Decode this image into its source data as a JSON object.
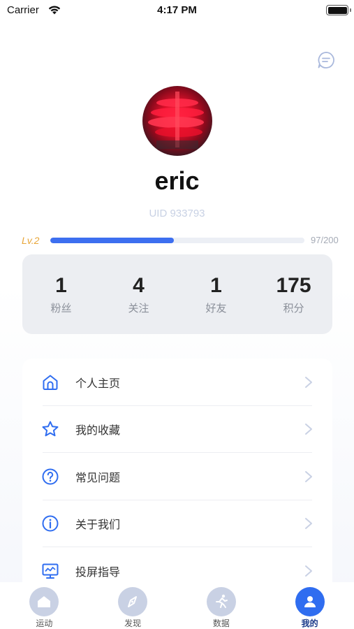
{
  "status_bar": {
    "carrier": "Carrier",
    "time": "4:17 PM"
  },
  "icons": {
    "message": "message-circle-icon",
    "tabs": [
      "home-icon",
      "compass-icon",
      "running-icon",
      "user-icon"
    ]
  },
  "profile": {
    "username": "eric",
    "uid": "UID 933793",
    "level": "Lv.2",
    "progress_text": "97/200",
    "progress_fraction": 0.485
  },
  "stats": [
    {
      "value": "1",
      "label": "粉丝"
    },
    {
      "value": "4",
      "label": "关注"
    },
    {
      "value": "1",
      "label": "好友"
    },
    {
      "value": "175",
      "label": "积分"
    }
  ],
  "menu": [
    {
      "label": "个人主页",
      "icon": "home-icon"
    },
    {
      "label": "我的收藏",
      "icon": "star-icon"
    },
    {
      "label": "常见问题",
      "icon": "question-icon"
    },
    {
      "label": "关于我们",
      "icon": "info-icon"
    },
    {
      "label": "投屏指导",
      "icon": "screen-cast-icon"
    }
  ],
  "tabs": [
    {
      "label": "运动",
      "active": false
    },
    {
      "label": "发现",
      "active": false
    },
    {
      "label": "数据",
      "active": false
    },
    {
      "label": "我的",
      "active": true
    }
  ],
  "colors": {
    "accent": "#2f6df0",
    "level": "#e8a63a",
    "progress": "#3d6ff0"
  }
}
